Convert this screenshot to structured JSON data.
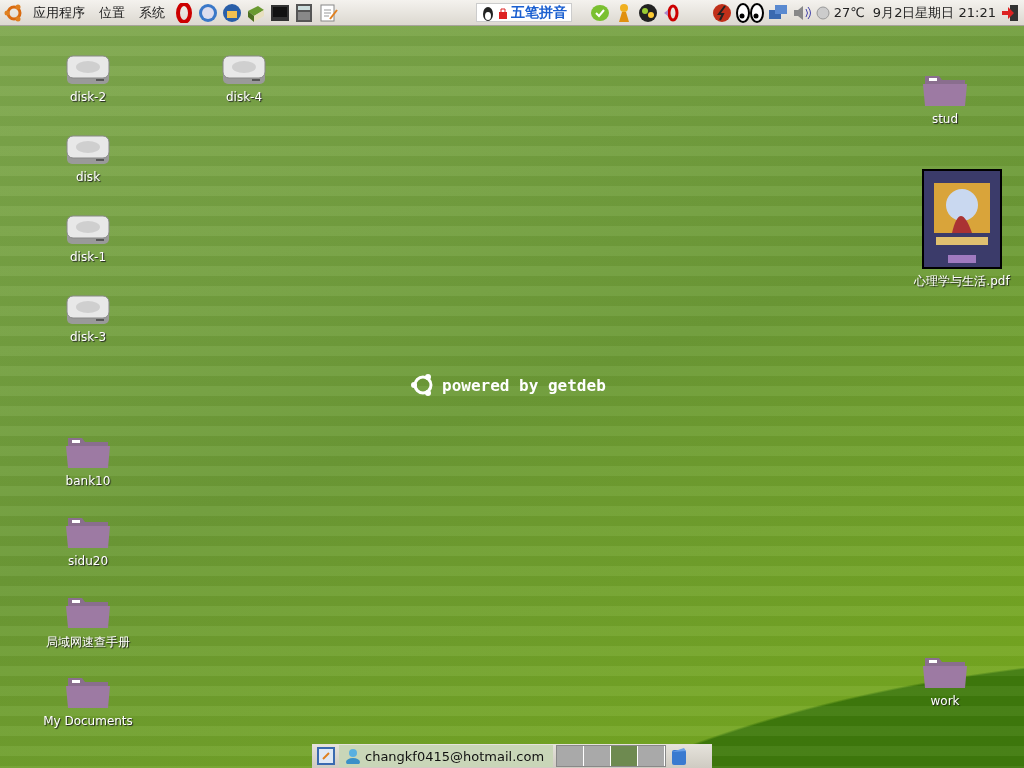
{
  "top_panel": {
    "menus": [
      {
        "label": "应用程序"
      },
      {
        "label": "位置"
      },
      {
        "label": "系统"
      }
    ],
    "input_method": {
      "label": "五笔拼音"
    },
    "weather": "27℃",
    "clock": "9月2日星期日 21:21"
  },
  "wallpaper": {
    "logo": "powered by getdeb"
  },
  "desktop_icons": [
    {
      "kind": "disk",
      "label": "disk-2"
    },
    {
      "kind": "disk",
      "label": "disk"
    },
    {
      "kind": "disk",
      "label": "disk-1"
    },
    {
      "kind": "disk",
      "label": "disk-3"
    },
    {
      "kind": "folder",
      "label": "bank10"
    },
    {
      "kind": "folder",
      "label": "sidu20"
    },
    {
      "kind": "folder",
      "label": "局域网速查手册"
    },
    {
      "kind": "folder",
      "label": "My Documents"
    },
    {
      "kind": "disk",
      "label": "disk-4"
    },
    {
      "kind": "folder",
      "label": "stud"
    },
    {
      "kind": "document",
      "label": "心理学与生活.pdf"
    },
    {
      "kind": "folder",
      "label": "work"
    }
  ],
  "bottom_panel": {
    "task": {
      "label": "changkf0415@hotmail.com"
    },
    "workspaces": [
      {
        "selected": false
      },
      {
        "selected": false
      },
      {
        "selected": true
      },
      {
        "selected": false
      }
    ]
  }
}
